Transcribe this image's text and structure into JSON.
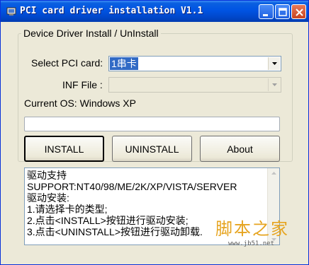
{
  "window": {
    "title": "PCI card driver installation V1.1"
  },
  "group": {
    "title": "Device Driver Install / UnInstall"
  },
  "select_pci": {
    "label": "Select PCI card:",
    "value": "1串卡"
  },
  "inf_file": {
    "label": "INF File :",
    "value": ""
  },
  "current_os": {
    "text": "Current OS: Windows XP"
  },
  "progress": {
    "value": 0
  },
  "buttons": {
    "install": "INSTALL",
    "uninstall": "UNINSTALL",
    "about": "About"
  },
  "info_text": {
    "lines": [
      "驱动支持",
      "SUPPORT:NT40/98/ME/2K/XP/VISTA/SERVER",
      "驱动安装:",
      "1.请选择卡的类型;",
      "2.点击<INSTALL>按钮进行驱动安装;",
      "3.点击<UNINSTALL>按钮进行驱动卸载."
    ]
  },
  "watermark": {
    "logo": "脚本之家",
    "url": "www.jb51.net"
  },
  "colors": {
    "titlebar": "#0054e3",
    "window_bg": "#ece9d8",
    "selection": "#316ac5",
    "close_button": "#c9431f"
  },
  "icons": {
    "app": "app-icon",
    "minimize": "minimize-icon",
    "maximize": "maximize-icon",
    "close": "close-icon",
    "dropdown": "chevron-down-icon",
    "scroll_up": "arrow-up-icon",
    "scroll_down": "arrow-down-icon"
  }
}
